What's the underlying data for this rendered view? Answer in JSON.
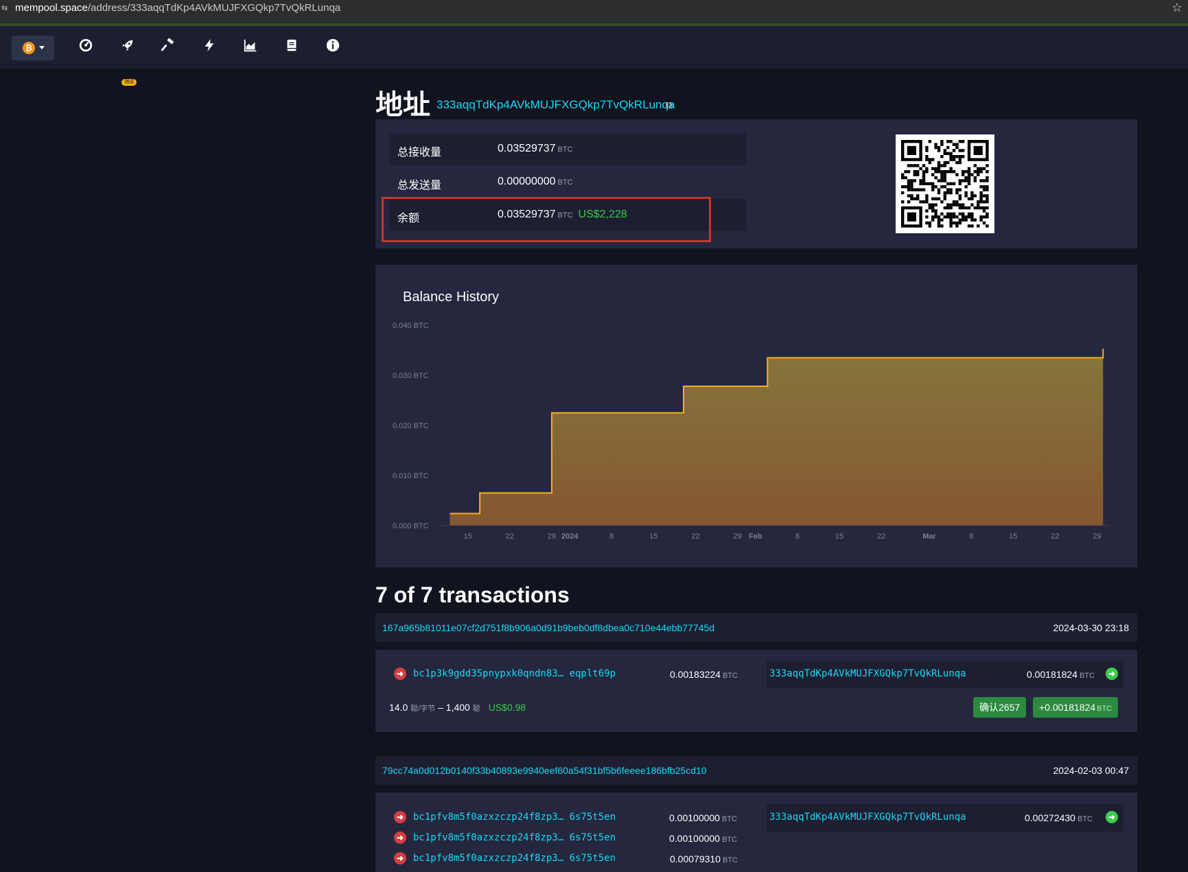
{
  "browser": {
    "url_host": "mempool.space",
    "url_path": "/address/333aqqTdKp4AVkMUJFXGQkp7TvQkRLunqa"
  },
  "nav": {
    "network_symbol": "₿",
    "badge": "测试"
  },
  "address": {
    "heading": "地址",
    "value": "333aqqTdKp4AVkMUJFXGQkp7TvQkRLunqa"
  },
  "summary": {
    "received_label": "总接收量",
    "received_value": "0.03529737",
    "sent_label": "总发送量",
    "sent_value": "0.00000000",
    "balance_label": "余额",
    "balance_value": "0.03529737",
    "balance_usd": "US$2,228",
    "unit": "BTC"
  },
  "chart_data": {
    "type": "area",
    "title": "Balance History",
    "ylabel": "",
    "y_ticks": [
      "0.040 BTC",
      "0.030 BTC",
      "0.020 BTC",
      "0.010 BTC",
      "0.000 BTC"
    ],
    "ylim": [
      0,
      0.04
    ],
    "x_ticks": [
      {
        "label": "15",
        "bold": false
      },
      {
        "label": "22",
        "bold": false
      },
      {
        "label": "29",
        "bold": false
      },
      {
        "label": "2024",
        "bold": true
      },
      {
        "label": "8",
        "bold": false
      },
      {
        "label": "15",
        "bold": false
      },
      {
        "label": "22",
        "bold": false
      },
      {
        "label": "29",
        "bold": false
      },
      {
        "label": "Feb",
        "bold": true
      },
      {
        "label": "8",
        "bold": false
      },
      {
        "label": "15",
        "bold": false
      },
      {
        "label": "22",
        "bold": false
      },
      {
        "label": "Mar",
        "bold": true
      },
      {
        "label": "8",
        "bold": false
      },
      {
        "label": "15",
        "bold": false
      },
      {
        "label": "22",
        "bold": false
      },
      {
        "label": "29",
        "bold": false
      }
    ],
    "steps": [
      {
        "date": "2023-12-12",
        "balance": 0.0024
      },
      {
        "date": "2023-12-17",
        "balance": 0.0065
      },
      {
        "date": "2023-12-29",
        "balance": 0.0225
      },
      {
        "date": "2024-01-20",
        "balance": 0.0278
      },
      {
        "date": "2024-02-03",
        "balance": 0.0335
      },
      {
        "date": "2024-03-30",
        "balance": 0.03529737
      }
    ],
    "colors": {
      "line": "#f7b21a",
      "fill_top": "#8b7a3c",
      "fill_bottom": "#8a5a30"
    }
  },
  "transactions": {
    "heading": "7 of 7 transactions",
    "items": [
      {
        "txid": "167a965b81011e07cf2d751f8b906a0d91b9beb0df8dbea0c710e44ebb77745d",
        "time": "2024-03-30 23:18",
        "inputs": [
          {
            "address": "bc1p3k9gdd35pnypxk0qndn83… eqplt69p",
            "amount": "0.00183224"
          }
        ],
        "outputs": [
          {
            "address": "333aqqTdKp4AVkMUJFXGQkp7TvQkRLunqa",
            "amount": "0.00181824"
          }
        ],
        "fee_rate": "14.0",
        "fee_rate_unit": "聪/字节",
        "fee": "1,400",
        "fee_unit": "聪",
        "fee_usd": "US$0.98",
        "confirmations": "确认2657",
        "net": "+0.00181824"
      },
      {
        "txid": "79cc74a0d012b0140f33b40893e9940eef60a54f31bf5b6feeee186bfb25cd10",
        "time": "2024-02-03 00:47",
        "inputs": [
          {
            "address": "bc1pfv8m5f0azxzczp24f8zp3… 6s75t5en",
            "amount": "0.00100000"
          },
          {
            "address": "bc1pfv8m5f0azxzczp24f8zp3… 6s75t5en",
            "amount": "0.00100000"
          },
          {
            "address": "bc1pfv8m5f0azxzczp24f8zp3… 6s75t5en",
            "amount": "0.00079310"
          }
        ],
        "outputs": [
          {
            "address": "333aqqTdKp4AVkMUJFXGQkp7TvQkRLunqa",
            "amount": "0.00272430"
          }
        ]
      }
    ]
  }
}
